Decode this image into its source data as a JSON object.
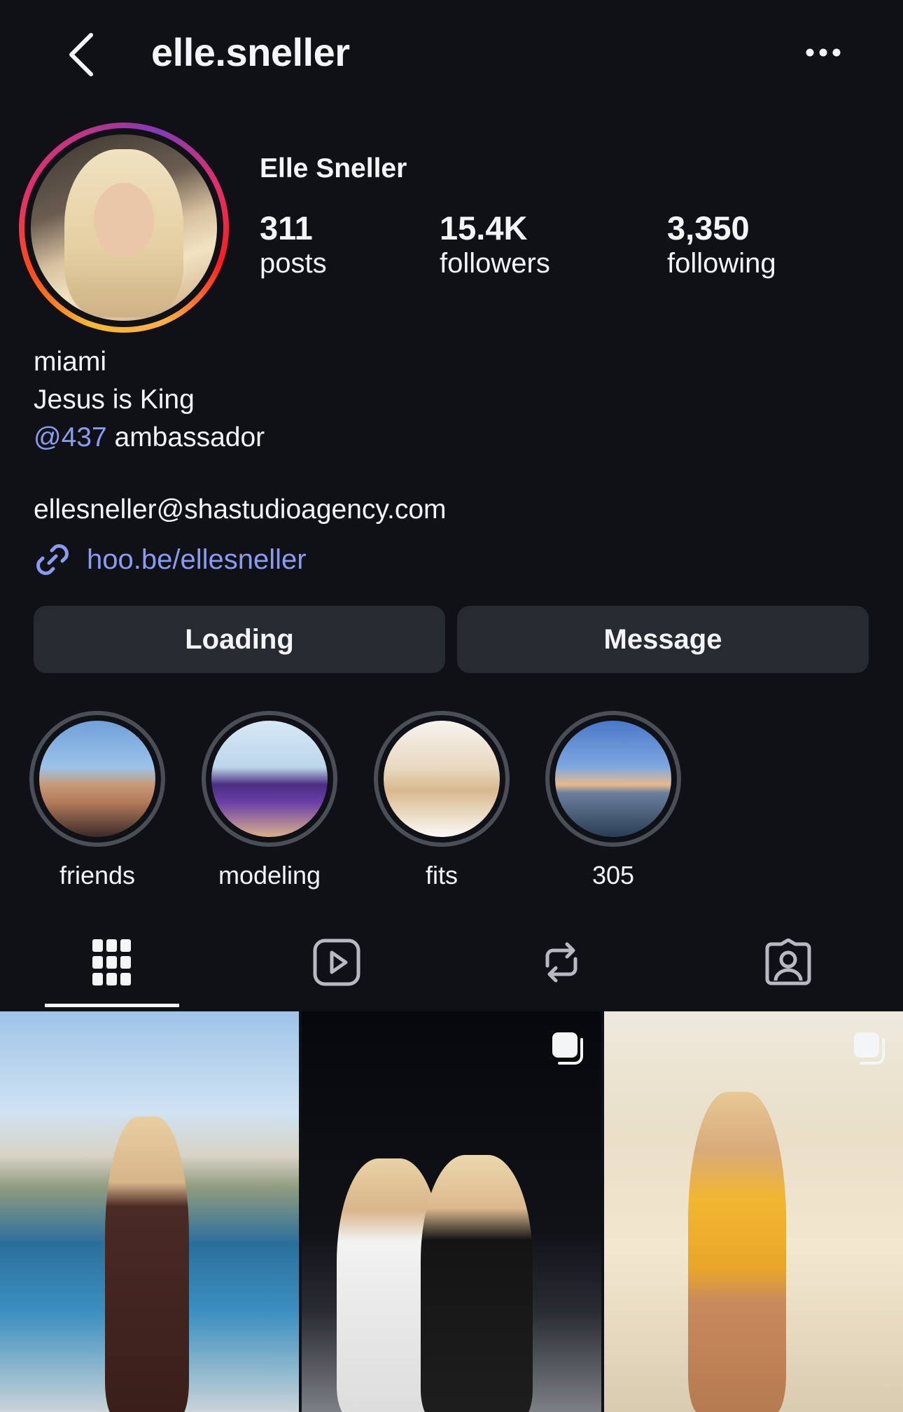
{
  "header": {
    "username": "elle.sneller"
  },
  "profile": {
    "display_name": "Elle Sneller",
    "stats": [
      {
        "value": "311",
        "label": "posts"
      },
      {
        "value": "15.4K",
        "label": "followers"
      },
      {
        "value": "3,350",
        "label": "following"
      }
    ],
    "bio": {
      "line1": "miami",
      "line2": "Jesus is King",
      "mention": "@437",
      "mention_suffix": " ambassador"
    },
    "email": "ellesneller@shastudioagency.com",
    "link": "hoo.be/ellesneller"
  },
  "actions": {
    "primary_label": "Loading",
    "message_label": "Message"
  },
  "highlights": [
    {
      "label": "friends"
    },
    {
      "label": "modeling"
    },
    {
      "label": "fits"
    },
    {
      "label": "305"
    }
  ],
  "tabs": [
    {
      "icon": "grid-icon",
      "active": true
    },
    {
      "icon": "reels-icon",
      "active": false
    },
    {
      "icon": "reposts-icon",
      "active": false
    },
    {
      "icon": "tagged-icon",
      "active": false
    }
  ],
  "posts": [
    {
      "multi": false
    },
    {
      "multi": true
    },
    {
      "multi": true
    }
  ],
  "colors": {
    "background": "#0f1117",
    "button": "#262a31",
    "link": "#8a9cf0",
    "text": "#f4f5f7"
  }
}
